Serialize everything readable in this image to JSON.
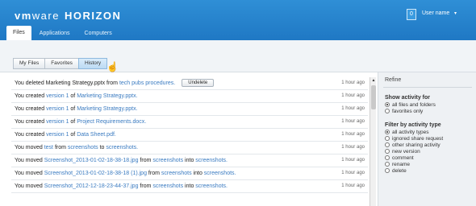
{
  "header": {
    "brand_vm": "vm",
    "brand_ware": "ware",
    "brand_product": "HORIZON",
    "notification_count": "0",
    "user_name": "User name",
    "user_caret": "▾"
  },
  "tabs": [
    {
      "label": "Files"
    },
    {
      "label": "Applications"
    },
    {
      "label": "Computers"
    }
  ],
  "subtabs": [
    {
      "label": "My Files"
    },
    {
      "label": "Favorites"
    },
    {
      "label": "History"
    }
  ],
  "activity": [
    {
      "prefix": "You deleted Marketing Strategy.pptx from ",
      "link1": "tech pubs procedures.",
      "mid": "",
      "link2": "",
      "suffix": "",
      "button": "Undelete",
      "time": "1 hour ago"
    },
    {
      "prefix": "You created ",
      "link1": "version 1",
      "mid": " of ",
      "link2": "Marketing Strategy.pptx.",
      "suffix": "",
      "button": "",
      "time": "1 hour ago"
    },
    {
      "prefix": "You created ",
      "link1": "version 1",
      "mid": " of ",
      "link2": "Marketing Strategy.pptx.",
      "suffix": "",
      "button": "",
      "time": "1 hour ago"
    },
    {
      "prefix": "You created ",
      "link1": "version 1",
      "mid": " of ",
      "link2": "Project Requirements.docx.",
      "suffix": "",
      "button": "",
      "time": "1 hour ago"
    },
    {
      "prefix": "You created ",
      "link1": "version 1",
      "mid": " of ",
      "link2": "Data Sheet.pdf.",
      "suffix": "",
      "button": "",
      "time": "1 hour ago"
    },
    {
      "prefix": "You moved ",
      "link1": "test",
      "mid": " from ",
      "link2": "screenshots",
      "suffix": " to ",
      "link3": "screenshots.",
      "button": "",
      "time": "1 hour ago"
    },
    {
      "prefix": "You moved ",
      "link1": "Screenshot_2013-01-02-18-38-18.jpg",
      "mid": " from ",
      "link2": "screenshots",
      "suffix": " into ",
      "link3": "screenshots.",
      "button": "",
      "time": "1 hour ago"
    },
    {
      "prefix": "You moved ",
      "link1": "Screenshot_2013-01-02-18-38-18 (1).jpg",
      "mid": " from ",
      "link2": "screenshots",
      "suffix": " into ",
      "link3": "screenshots.",
      "button": "",
      "time": "1 hour ago"
    },
    {
      "prefix": "You moved ",
      "link1": "Screenshot_2012-12-18-23-44-37.jpg",
      "mid": " from ",
      "link2": "screenshots",
      "suffix": " into ",
      "link3": "screenshots.",
      "button": "",
      "time": "1 hour ago"
    }
  ],
  "refine": {
    "title": "Refine",
    "show_heading": "Show activity for",
    "show_options": [
      {
        "label": "all files and folders",
        "selected": true
      },
      {
        "label": "favorites only",
        "selected": false
      }
    ],
    "filter_heading": "Filter by activity type",
    "filter_options": [
      {
        "label": "all activity types",
        "selected": true
      },
      {
        "label": "ignored share request",
        "selected": false
      },
      {
        "label": "other sharing activity",
        "selected": false
      },
      {
        "label": "new version",
        "selected": false
      },
      {
        "label": "comment",
        "selected": false
      },
      {
        "label": "rename",
        "selected": false
      },
      {
        "label": "delete",
        "selected": false
      }
    ]
  },
  "scrollbar": {
    "up_arrow": "▲"
  },
  "colors": {
    "header_blue": "#1f78c4",
    "link_blue": "#3a7bc1"
  }
}
